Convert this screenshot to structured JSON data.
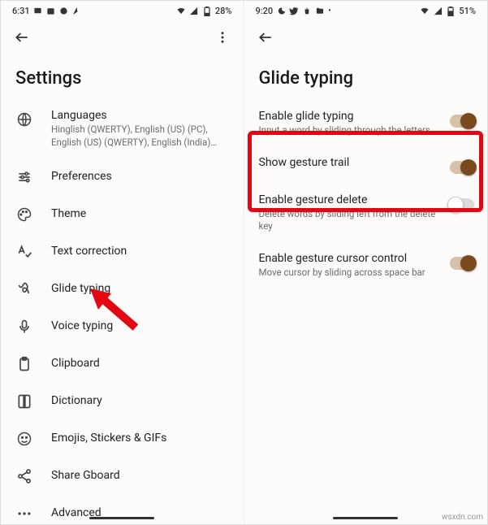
{
  "left": {
    "status": {
      "time": "6:31",
      "battery": "28%"
    },
    "title": "Settings",
    "items": [
      {
        "label": "Languages",
        "sub": "Hinglish (QWERTY), English (US) (PC), English (US) (QWERTY), English (India) (QWERTY), Kas…"
      },
      {
        "label": "Preferences"
      },
      {
        "label": "Theme"
      },
      {
        "label": "Text correction"
      },
      {
        "label": "Glide typing"
      },
      {
        "label": "Voice typing"
      },
      {
        "label": "Clipboard"
      },
      {
        "label": "Dictionary"
      },
      {
        "label": "Emojis, Stickers & GIFs"
      },
      {
        "label": "Share Gboard"
      },
      {
        "label": "Advanced"
      }
    ]
  },
  "right": {
    "status": {
      "time": "9:20",
      "battery": "51%"
    },
    "title": "Glide typing",
    "settings": [
      {
        "label": "Enable glide typing",
        "sub": "Input a word by sliding through the letters",
        "on": true
      },
      {
        "label": "Show gesture trail",
        "on": true
      },
      {
        "label": "Enable gesture delete",
        "sub": "Delete words by sliding left from the delete key",
        "on": false
      },
      {
        "label": "Enable gesture cursor control",
        "sub": "Move cursor by sliding across space bar",
        "on": true
      }
    ]
  },
  "watermark": "wsxdn.com"
}
